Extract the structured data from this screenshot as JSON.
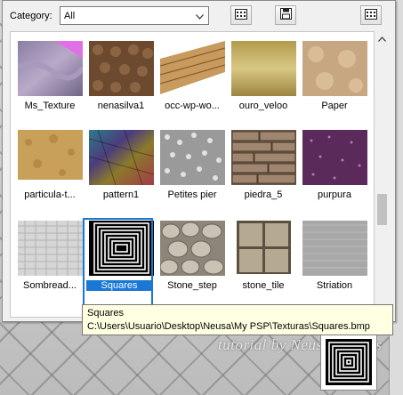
{
  "toolbar": {
    "category_label": "Category:",
    "category_value": "All",
    "buttons": [
      "view-grid-icon",
      "save-preset-icon",
      "view-large-icon"
    ]
  },
  "tiles": [
    {
      "name": "Ms_Texture"
    },
    {
      "name": "nenasilva1"
    },
    {
      "name": "occ-wp-wo..."
    },
    {
      "name": "ouro_veloo"
    },
    {
      "name": "Paper"
    },
    {
      "name": "particula-t..."
    },
    {
      "name": "pattern1"
    },
    {
      "name": "Petites pier"
    },
    {
      "name": "piedra_5"
    },
    {
      "name": "purpura"
    },
    {
      "name": "Sombread..."
    },
    {
      "name": "Squares",
      "selected": true
    },
    {
      "name": "Stone_step"
    },
    {
      "name": "stone_tile"
    },
    {
      "name": "Striation"
    }
  ],
  "tooltip": {
    "title": "Squares",
    "path": "C:\\Users\\Usuario\\Desktop\\Neusa\\My PSP\\Texturas\\Squares.bmp"
  },
  "background": {
    "watermark": "tutorial by Neusa Novaes"
  },
  "colors": {
    "selection": "#1a78d4",
    "tooltip_bg": "#ffffe1"
  }
}
